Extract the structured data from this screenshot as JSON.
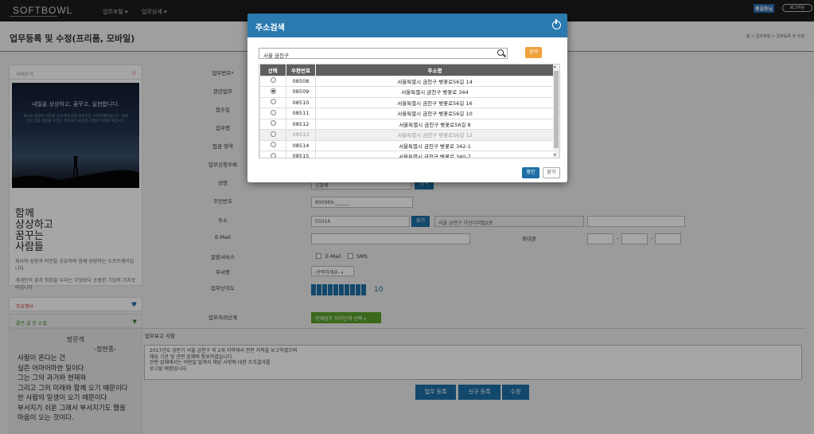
{
  "app": {
    "logo": "SOFTBOWL",
    "nav": [
      "업무포털 ▾",
      "업무상세 ▾"
    ],
    "user": "홍길동님",
    "logout": "로그아웃"
  },
  "page": {
    "title": "업무등록 및 수정(프리폼, 모바일)",
    "breadcrumb": "홈 > 업무포털 > 업무등록 및 수정"
  },
  "sidebar": {
    "notice_label": "사내소식",
    "image_text": "내일을 상상하고, 꿈꾸고, 실현합니다.",
    "image_sub": "회사의 성장과 비전을 공유하며 함께 성장하는 소프트웨어입니다. 개개인의 꿈과 희망을 우리는 무엇보다 소중한 기업의 가치로 여깁니다.",
    "big_copy": [
      "함께",
      "상상하고",
      "꿈꾸는",
      "사람들"
    ],
    "copy1": "회사의 성장과 비전을 공유하며 함께 성장하는 소프트웨어입니다.",
    "copy2": "개개인의 꿈과 희망을 우리는 무엇보다 소중한 기업의 가치로 여깁니다.",
    "section1": "주요행사",
    "section2": "좋은 글 한 소절",
    "poem_title": "방문객",
    "poem_author": "-정현종-",
    "poem_lines": [
      "사람이 온다는 건",
      "실은 어마어마한 일이다",
      "그는 그의 과거와 현재와",
      "그리고 그의 미래와 함께 오기 때문이다",
      "한 사람의 일생이 오기 때문이다",
      "부서지기 쉬운 그래서 부서지기도 했을",
      "마음이 오는 것이다."
    ]
  },
  "form": {
    "labels": [
      "업무번호*",
      "관련업무",
      "접수일",
      "업무명",
      "접금 영역",
      "업무신청주체",
      "성명",
      "주민번호",
      "주소",
      "E-Mail",
      "알림서비스",
      "부서명",
      "업무난이도",
      "업무처리단계"
    ],
    "name_value": "김말례",
    "name_btn": "검색",
    "ssn_value": "890989-______",
    "zip_value": "55014",
    "find_btn": "찾기",
    "addr_value": "서울 금천구 가산디지털2로",
    "mobile_label": "휴대폰",
    "alert_email": "E-Mail",
    "alert_sms": "SMS",
    "dept_select": "-선택하세요-",
    "difficulty_value": "10",
    "stage_select": "현재업무 처리단계 선택",
    "report_label": "업무보고 사항",
    "report_text": [
      "2017년도 상반기 서울 금천구 외 2개 지역에서 관련 지적을 보고하였으며",
      "해당 기관 및 관련 업체에 통보하였습니다.",
      "관련 업체에서는 이번달 말까지 해당 사항에 대한 조치결과를",
      "보고할 예정입니다."
    ],
    "buttons": [
      "업무 등록",
      "신규 등록",
      "수정"
    ]
  },
  "modal": {
    "title": "주소검색",
    "search_value": "서울 금천구",
    "search_btn": "검색",
    "columns": [
      "선택",
      "우편번호",
      "주소명"
    ],
    "rows": [
      {
        "zip": "08508",
        "addr": "서울특별시 금천구 벚꽃로56길 14",
        "selected": false
      },
      {
        "zip": "08509",
        "addr": "서울특별시 금천구 벚꽃로 344",
        "selected": true
      },
      {
        "zip": "08510",
        "addr": "서울특별시 금천구 벚꽃로56길 16",
        "selected": false
      },
      {
        "zip": "08511",
        "addr": "서울특별시 금천구 벚꽃로56길 10",
        "selected": false
      },
      {
        "zip": "08512",
        "addr": "서울특별시 금천구 벚꽃로56길 8",
        "selected": false
      },
      {
        "zip": "08513",
        "addr": "서울특별시 금천구 벚꽃로56길 12",
        "selected": false
      },
      {
        "zip": "08514",
        "addr": "서울특별시 금천구 벚꽃로 342-1",
        "selected": false
      },
      {
        "zip": "08515",
        "addr": "서울특별시 금천구 벚꽃로 340-7",
        "selected": false
      }
    ],
    "ok_btn": "확인",
    "close_btn": "닫기"
  }
}
